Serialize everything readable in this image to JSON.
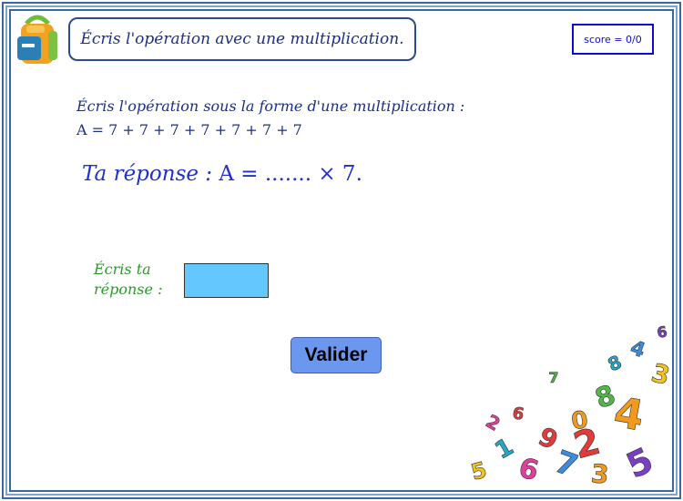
{
  "header": {
    "title": "Écris l'opération avec une multiplication.",
    "score": "score = 0/0"
  },
  "instructions": {
    "line1": "Écris l'opération sous la forme d'une multiplication :",
    "line2": "A = 7 + 7 + 7 + 7 + 7 + 7 + 7"
  },
  "answer_prompt": {
    "label": "Ta réponse :",
    "expression_start": "A = ....... × 7."
  },
  "input": {
    "label_line1": "Écris ta",
    "label_line2": "réponse :",
    "value": ""
  },
  "buttons": {
    "validate": "Valider"
  },
  "decoration": {
    "digits": [
      "2",
      "4",
      "7",
      "5",
      "6",
      "8",
      "3",
      "1",
      "9",
      "0",
      "4",
      "6",
      "2",
      "7",
      "5",
      "8",
      "6",
      "3"
    ]
  },
  "colors": {
    "frame": "#3a66a8",
    "title_text": "#1a2f8a",
    "answer_text": "#1f2fd0",
    "label_green": "#2a9a2a",
    "input_bg": "#64c8ff",
    "button_bg": "#6b97ee"
  }
}
